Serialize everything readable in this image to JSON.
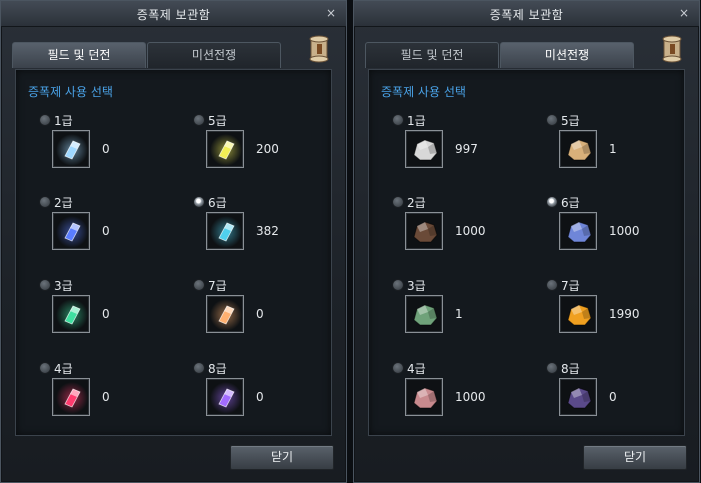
{
  "windows": [
    {
      "title": "증폭제 보관함",
      "close": "×",
      "tabs": [
        "필드 및 던전",
        "미션전쟁"
      ],
      "active_tab": 0,
      "section_title": "증폭제 사용 선택",
      "close_button": "닫기",
      "items": [
        {
          "grade": "1급",
          "count": "0",
          "selected": false,
          "icon": "crystal-icon",
          "color": "#9fd8ff"
        },
        {
          "grade": "2급",
          "count": "0",
          "selected": false,
          "icon": "crystal-icon",
          "color": "#5a7dff"
        },
        {
          "grade": "3급",
          "count": "0",
          "selected": false,
          "icon": "crystal-icon",
          "color": "#3ee0a0"
        },
        {
          "grade": "4급",
          "count": "0",
          "selected": false,
          "icon": "crystal-icon",
          "color": "#ff3b6e"
        },
        {
          "grade": "5급",
          "count": "200",
          "selected": false,
          "icon": "crystal-icon",
          "color": "#f2ef55"
        },
        {
          "grade": "6급",
          "count": "382",
          "selected": true,
          "icon": "crystal-icon",
          "color": "#4fd0ee"
        },
        {
          "grade": "7급",
          "count": "0",
          "selected": false,
          "icon": "crystal-icon",
          "color": "#ffb070"
        },
        {
          "grade": "8급",
          "count": "0",
          "selected": false,
          "icon": "crystal-icon",
          "color": "#a26bff"
        }
      ]
    },
    {
      "title": "증폭제 보관함",
      "close": "×",
      "tabs": [
        "필드 및 던전",
        "미션전쟁"
      ],
      "active_tab": 1,
      "section_title": "증폭제 사용 선택",
      "close_button": "닫기",
      "items": [
        {
          "grade": "1급",
          "count": "997",
          "selected": false,
          "icon": "ore-icon",
          "color": "#d8d8d8"
        },
        {
          "grade": "2급",
          "count": "1000",
          "selected": false,
          "icon": "ore-icon",
          "color": "#6a4a38"
        },
        {
          "grade": "3급",
          "count": "1",
          "selected": false,
          "icon": "ore-icon",
          "color": "#6fa27a"
        },
        {
          "grade": "4급",
          "count": "1000",
          "selected": false,
          "icon": "ore-icon",
          "color": "#c88a8e"
        },
        {
          "grade": "5급",
          "count": "1",
          "selected": false,
          "icon": "ore-icon",
          "color": "#d8b07a"
        },
        {
          "grade": "6급",
          "count": "1000",
          "selected": true,
          "icon": "ore-icon",
          "color": "#6f86d8"
        },
        {
          "grade": "7급",
          "count": "1990",
          "selected": false,
          "icon": "ore-icon",
          "color": "#f0a020"
        },
        {
          "grade": "8급",
          "count": "0",
          "selected": false,
          "icon": "ore-icon",
          "color": "#5a4a8a"
        }
      ]
    }
  ]
}
